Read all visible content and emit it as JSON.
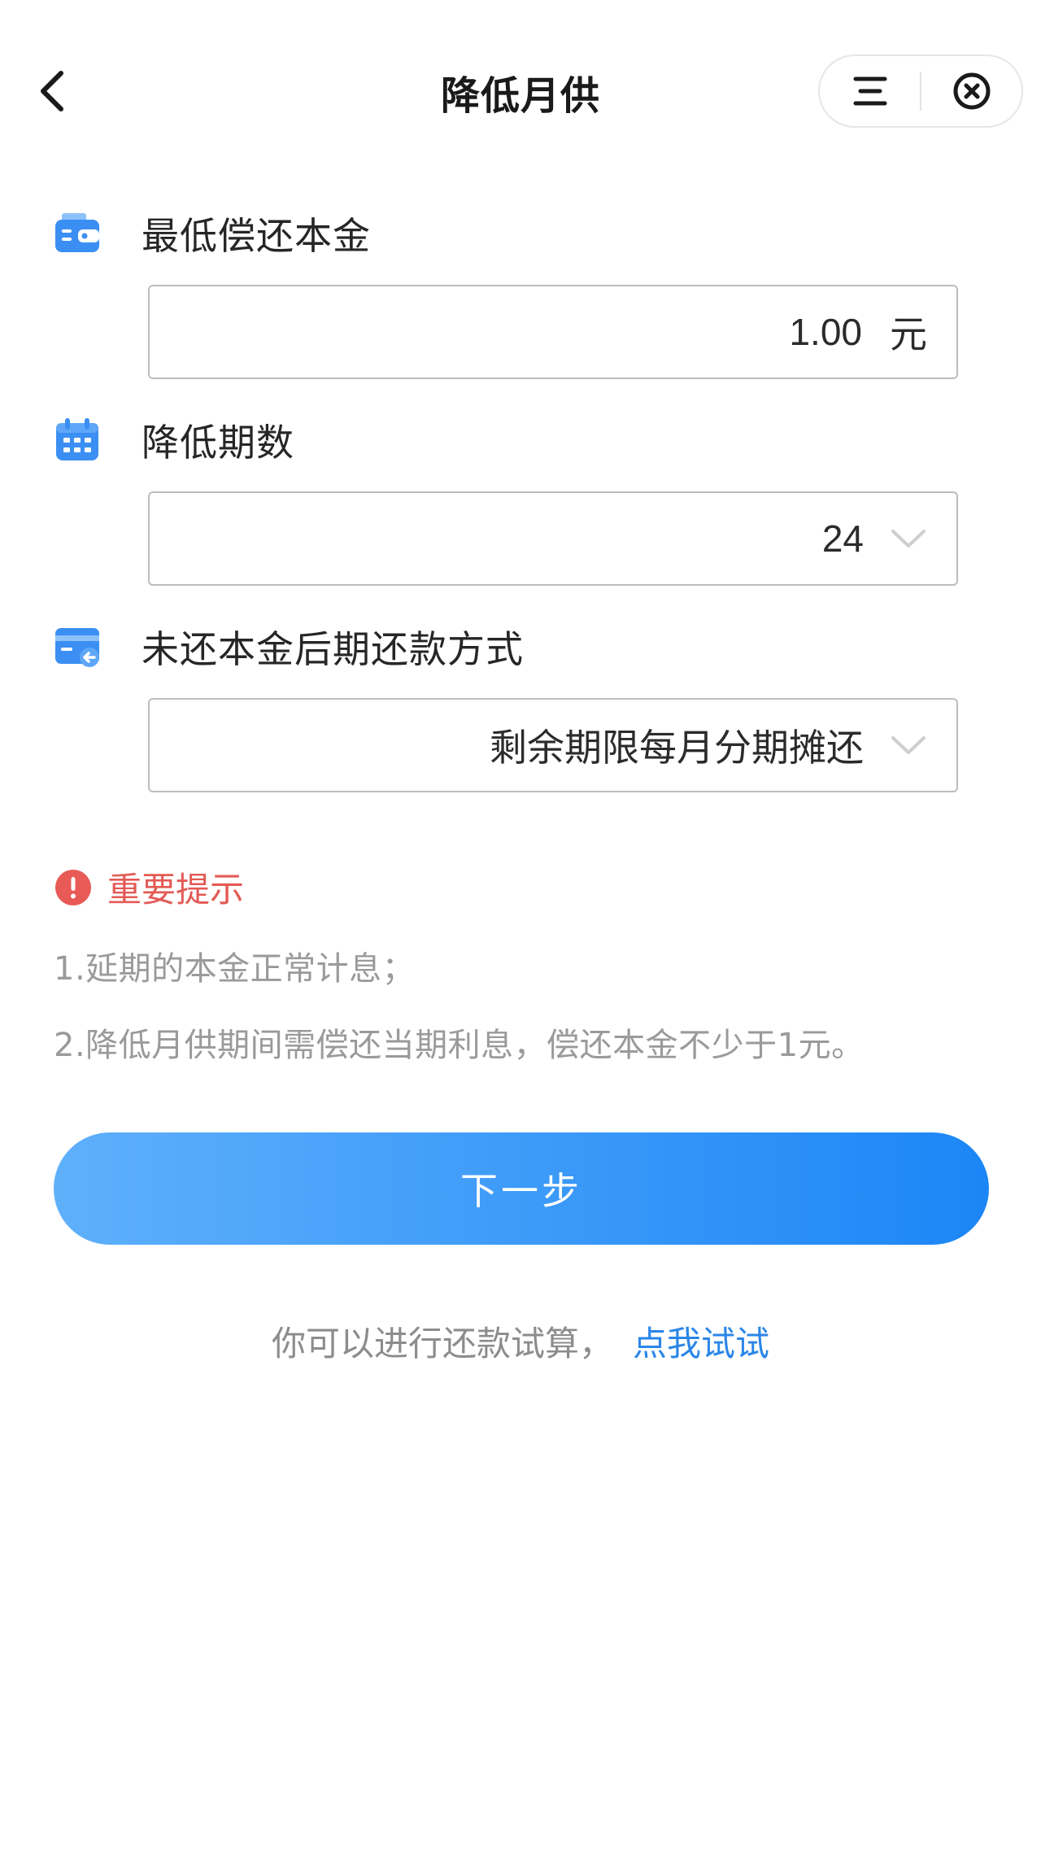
{
  "header": {
    "title": "降低月供",
    "back_icon": "back-arrow-icon",
    "menu_icon": "menu-icon",
    "close_icon": "close-circle-icon"
  },
  "form": {
    "principal": {
      "label": "最低偿还本金",
      "icon": "wallet-icon",
      "value": "1.00",
      "unit": "元"
    },
    "periods": {
      "label": "降低期数",
      "icon": "calendar-icon",
      "value": "24"
    },
    "repay_method": {
      "label": "未还本金后期还款方式",
      "icon": "card-return-icon",
      "value": "剩余期限每月分期摊还"
    }
  },
  "notice": {
    "icon": "warning-icon",
    "title": "重要提示",
    "lines": [
      "1.延期的本金正常计息；",
      "2.降低月供期间需偿还当期利息，偿还本金不少于1元。"
    ]
  },
  "actions": {
    "next_label": "下一步"
  },
  "hint": {
    "text": "你可以进行还款试算，",
    "link": "点我试试"
  },
  "colors": {
    "accent_start": "#5fb0fb",
    "accent_end": "#1c86f6",
    "warning": "#e35a55",
    "link": "#2b86e8",
    "icon_blue": "#3b8ff3"
  }
}
